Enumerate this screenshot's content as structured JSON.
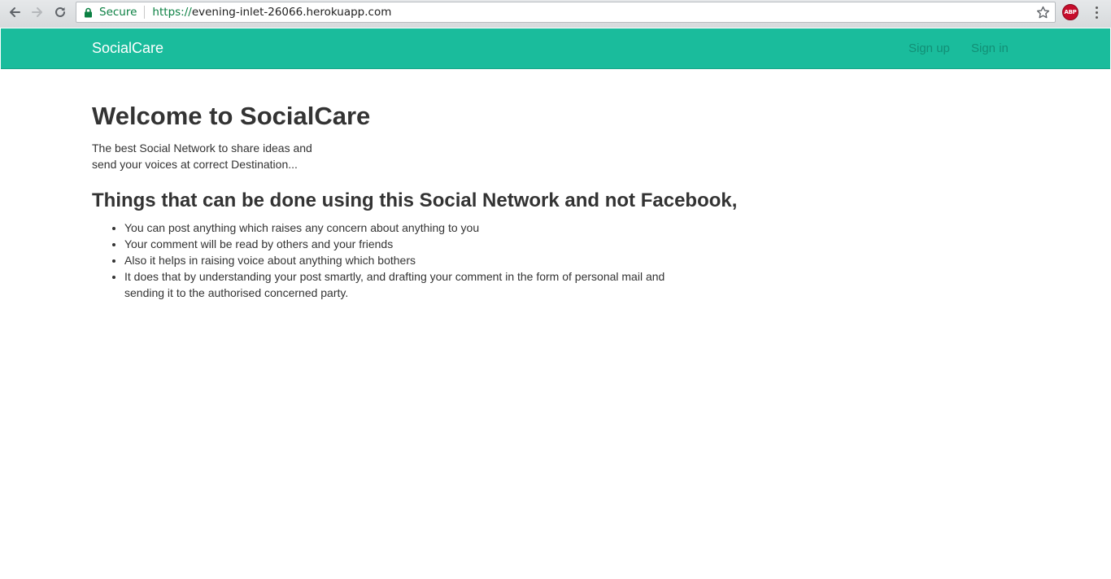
{
  "browser": {
    "secure_label": "Secure",
    "url_scheme": "https://",
    "url_host": "evening-inlet-26066.herokuapp.com",
    "extension_label": "ABP",
    "icons": [
      "back-arrow-icon",
      "forward-arrow-icon",
      "reload-icon",
      "lock-icon",
      "star-icon",
      "adblock-icon",
      "kebab-menu-icon"
    ]
  },
  "navbar": {
    "brand": "SocialCare",
    "links": [
      {
        "label": "Sign up"
      },
      {
        "label": "Sign in"
      }
    ],
    "colors": {
      "background": "#1abc9c",
      "brand_text": "#ffffff",
      "link_text": "#128f76"
    }
  },
  "main": {
    "title": "Welcome to SocialCare",
    "intro_line1": "The best Social Network to share ideas and",
    "intro_line2": "send your voices at correct Destination...",
    "section_title": "Things that can be done using this Social Network and not Facebook,",
    "features": [
      "You can post anything which raises any concern about anything to you",
      "Your comment will be read by others and your friends",
      "Also it helps in raising voice about anything which bothers",
      "It does that by understanding your post smartly, and drafting your comment in the form of personal mail and sending it to the authorised concerned party."
    ]
  }
}
